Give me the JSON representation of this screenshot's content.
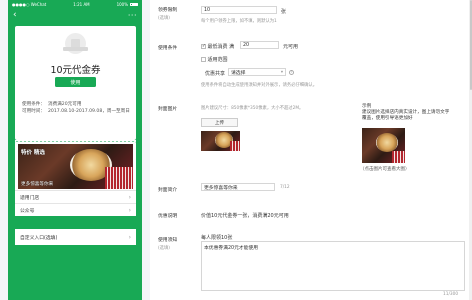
{
  "phone": {
    "status": {
      "carrier": "●●●●○ WeChat",
      "time": "1:21 AM",
      "battery": "100%"
    },
    "coupon": {
      "title": "10元代金券",
      "use_button": "使用",
      "info": [
        {
          "k": "使用条件：",
          "v": "消费满20元可用"
        },
        {
          "k": "可用时间：",
          "v": "2017.08.10-2017.09.08，周一至周日"
        }
      ]
    },
    "banner": {
      "title": "特价 精选",
      "caption": "更多惊喜等你来"
    },
    "list": [
      "适用门店",
      "公众号"
    ],
    "entry": "自定义入口(选填)"
  },
  "form": {
    "limit": {
      "label": "领券限制",
      "sub": "(选填)",
      "value": "10",
      "unit": "张",
      "hint": "每个用户领券上限，如不填，则默认为1"
    },
    "condition": {
      "label": "使用条件",
      "min_spend_label": "最低消费 满",
      "min_spend_value": "20",
      "min_spend_unit": "元可用",
      "min_spend_checked": true,
      "scope_label": "适用范围",
      "scope_checked": false,
      "share_label": "优惠共享",
      "share_select": "请选择",
      "hint": "使用条件将自动生成使用须知并对外展示，请务必仔细确认。"
    },
    "cover": {
      "label": "封面图片",
      "hint": "图片建议尺寸：850像素*350像素，大小不超过2M。",
      "upload_button": "上传"
    },
    "example": {
      "title": "示例",
      "desc": "建议图片选择店内真实设计，图上请勿文字覆盖，使用引导语更加好",
      "caption": "（点击图片可查看大图）"
    },
    "summary": {
      "label": "封面简介",
      "value": "更多惊喜等你来",
      "count": "7/12"
    },
    "offer": {
      "label": "优惠说明",
      "value": "价值10元代金券一张，消费满20元可用"
    },
    "notes": {
      "label": "使用须知",
      "sub": "(选填)",
      "line1": "每人限领10张",
      "line2": "本优惠券满20元才能使用",
      "count": "11/300"
    }
  },
  "colors": {
    "brand_green": "#18a955"
  }
}
